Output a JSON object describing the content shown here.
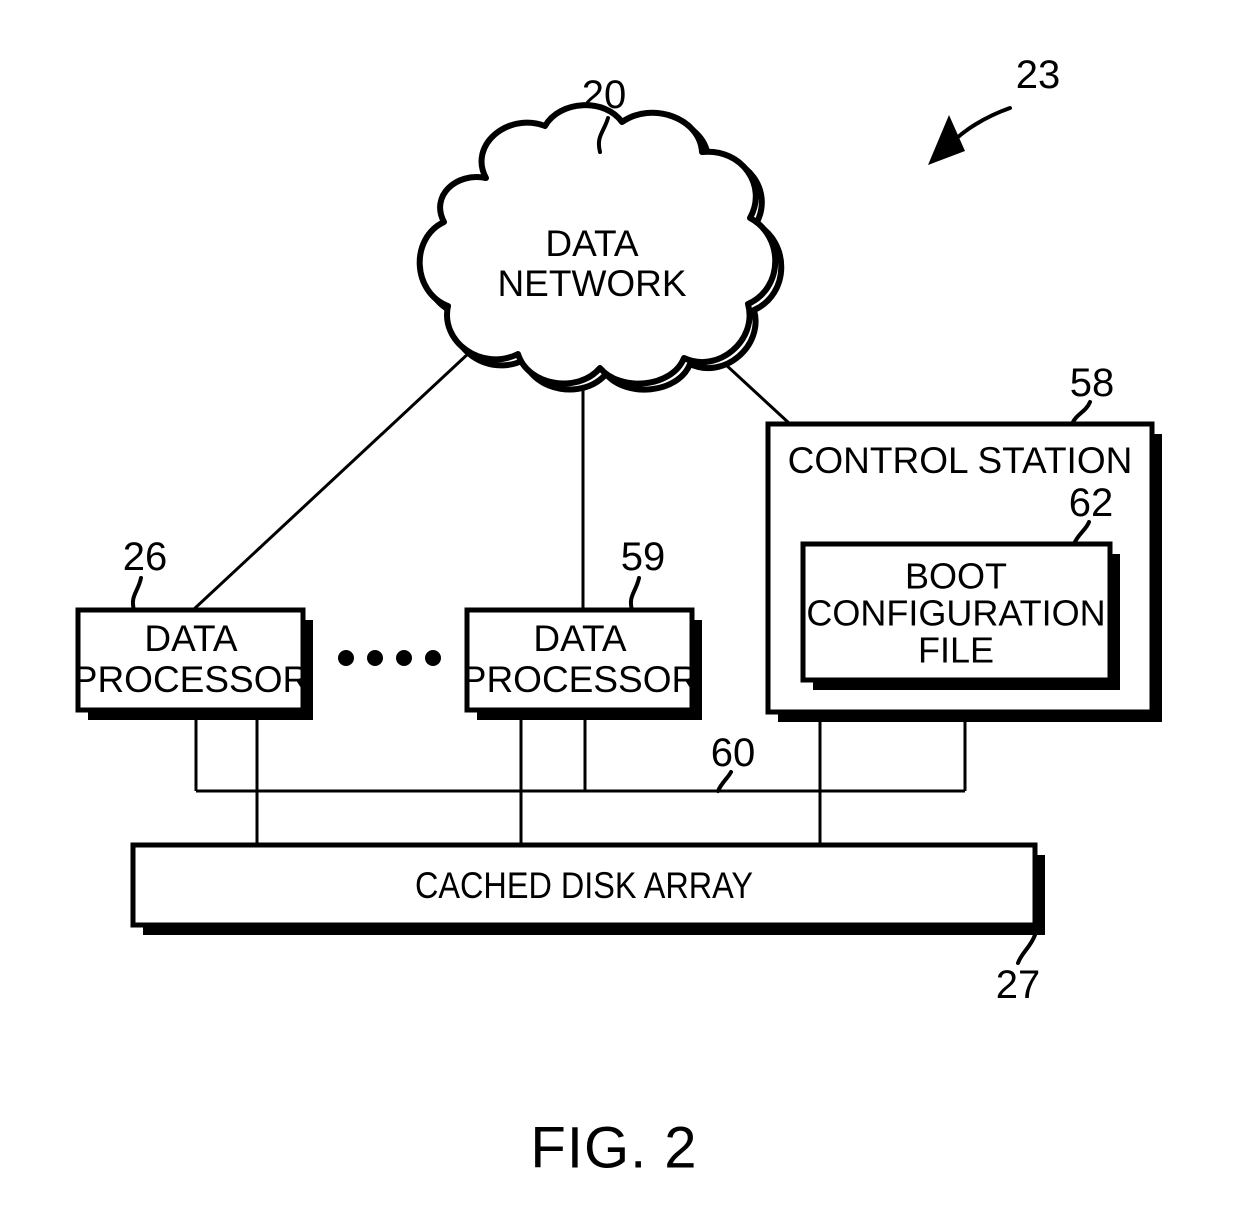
{
  "figure": {
    "caption": "FIG. 2",
    "assembly_ref": "23"
  },
  "nodes": {
    "network": {
      "label_line1": "DATA",
      "label_line2": "NETWORK",
      "ref": "20"
    },
    "data_processor_1": {
      "label_line1": "DATA",
      "label_line2": "PROCESSOR",
      "ref": "26"
    },
    "data_processor_n": {
      "label_line1": "DATA",
      "label_line2": "PROCESSOR",
      "ref": "59"
    },
    "control_station": {
      "label": "CONTROL STATION",
      "ref": "58"
    },
    "boot_configuration_file": {
      "label_line1": "BOOT",
      "label_line2": "CONFIGURATION",
      "label_line3": "FILE",
      "ref": "62"
    },
    "cached_disk_array": {
      "label": "CACHED DISK ARRAY",
      "ref": "27"
    },
    "internal_bus": {
      "ref": "60"
    }
  },
  "ellipsis": {
    "glyph": "•",
    "count": 4
  },
  "colors": {
    "line": "#000000",
    "fill": "#ffffff",
    "shadow": "#000000"
  }
}
